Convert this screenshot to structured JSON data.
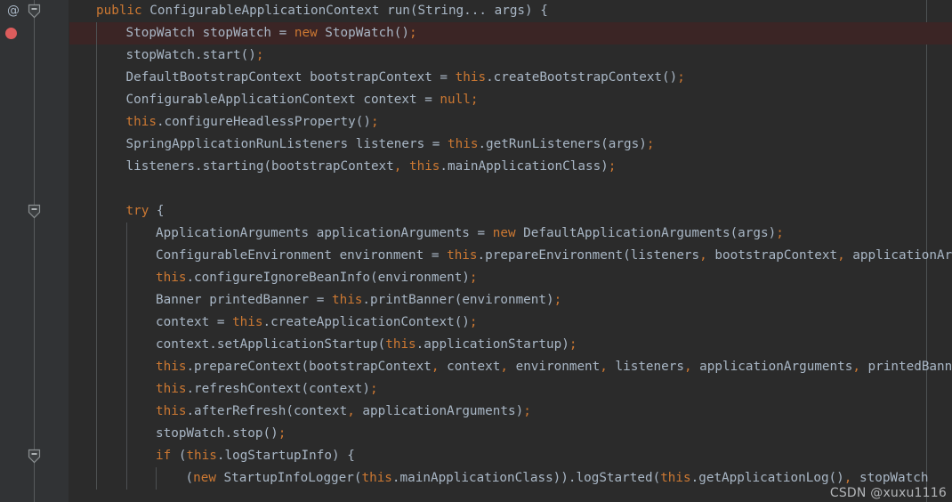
{
  "editor": {
    "theme_name": "darcula",
    "colors": {
      "background": "#2b2b2b",
      "gutter_background": "#313335",
      "foreground": "#a9b7c6",
      "keyword": "#cc7832",
      "breakpoint_line_background": "#3b2525",
      "breakpoint_dot": "#db5c5c",
      "indent_guide": "#4d5052",
      "margin_guide": "#4e5254"
    }
  },
  "gutter": {
    "annotation_icon": "@",
    "annotation_icon_name": "annotation-marker-icon",
    "breakpoint_icon_name": "breakpoint-dot-icon",
    "fold_icon_name": "code-fold-collapse-icon",
    "fold_markers": [
      0,
      9,
      20
    ]
  },
  "watermark": {
    "text": "CSDN @xuxu1116"
  },
  "code": {
    "language": "java",
    "lines": [
      {
        "indent": 0,
        "highlight": false,
        "guides": [],
        "tokens": [
          {
            "t": "public",
            "c": "kw"
          },
          {
            "t": " ConfigurableApplicationContext run(String... args) {",
            "c": "txt"
          }
        ]
      },
      {
        "indent": 1,
        "highlight": true,
        "guides": [
          0
        ],
        "tokens": [
          {
            "t": "StopWatch stopWatch = ",
            "c": "txt"
          },
          {
            "t": "new",
            "c": "kw"
          },
          {
            "t": " StopWatch()",
            "c": "txt"
          },
          {
            "t": ";",
            "c": "sem"
          }
        ]
      },
      {
        "indent": 1,
        "highlight": false,
        "guides": [
          0
        ],
        "tokens": [
          {
            "t": "stopWatch.start()",
            "c": "txt"
          },
          {
            "t": ";",
            "c": "sem"
          }
        ]
      },
      {
        "indent": 1,
        "highlight": false,
        "guides": [
          0
        ],
        "tokens": [
          {
            "t": "DefaultBootstrapContext bootstrapContext = ",
            "c": "txt"
          },
          {
            "t": "this",
            "c": "kw"
          },
          {
            "t": ".createBootstrapContext()",
            "c": "txt"
          },
          {
            "t": ";",
            "c": "sem"
          }
        ]
      },
      {
        "indent": 1,
        "highlight": false,
        "guides": [
          0
        ],
        "tokens": [
          {
            "t": "ConfigurableApplicationContext context = ",
            "c": "txt"
          },
          {
            "t": "null",
            "c": "kw"
          },
          {
            "t": ";",
            "c": "sem"
          }
        ]
      },
      {
        "indent": 1,
        "highlight": false,
        "guides": [
          0
        ],
        "tokens": [
          {
            "t": "this",
            "c": "kw"
          },
          {
            "t": ".configureHeadlessProperty()",
            "c": "txt"
          },
          {
            "t": ";",
            "c": "sem"
          }
        ]
      },
      {
        "indent": 1,
        "highlight": false,
        "guides": [
          0
        ],
        "tokens": [
          {
            "t": "SpringApplicationRunListeners listeners = ",
            "c": "txt"
          },
          {
            "t": "this",
            "c": "kw"
          },
          {
            "t": ".getRunListeners(args)",
            "c": "txt"
          },
          {
            "t": ";",
            "c": "sem"
          }
        ]
      },
      {
        "indent": 1,
        "highlight": false,
        "guides": [
          0
        ],
        "tokens": [
          {
            "t": "listeners.starting(bootstrapContext",
            "c": "txt"
          },
          {
            "t": ",",
            "c": "sem"
          },
          {
            "t": " ",
            "c": "txt"
          },
          {
            "t": "this",
            "c": "kw"
          },
          {
            "t": ".mainApplicationClass)",
            "c": "txt"
          },
          {
            "t": ";",
            "c": "sem"
          }
        ]
      },
      {
        "indent": 0,
        "highlight": false,
        "guides": [
          0
        ],
        "tokens": []
      },
      {
        "indent": 1,
        "highlight": false,
        "guides": [
          0
        ],
        "tokens": [
          {
            "t": "try",
            "c": "kw"
          },
          {
            "t": " {",
            "c": "txt"
          }
        ]
      },
      {
        "indent": 2,
        "highlight": false,
        "guides": [
          0,
          1
        ],
        "tokens": [
          {
            "t": "ApplicationArguments applicationArguments = ",
            "c": "txt"
          },
          {
            "t": "new",
            "c": "kw"
          },
          {
            "t": " DefaultApplicationArguments(args)",
            "c": "txt"
          },
          {
            "t": ";",
            "c": "sem"
          }
        ]
      },
      {
        "indent": 2,
        "highlight": false,
        "guides": [
          0,
          1
        ],
        "tokens": [
          {
            "t": "ConfigurableEnvironment environment = ",
            "c": "txt"
          },
          {
            "t": "this",
            "c": "kw"
          },
          {
            "t": ".prepareEnvironment(listeners",
            "c": "txt"
          },
          {
            "t": ",",
            "c": "sem"
          },
          {
            "t": " bootstrapContext",
            "c": "txt"
          },
          {
            "t": ",",
            "c": "sem"
          },
          {
            "t": " applicationArguments)",
            "c": "txt"
          },
          {
            "t": ";",
            "c": "sem"
          }
        ]
      },
      {
        "indent": 2,
        "highlight": false,
        "guides": [
          0,
          1
        ],
        "tokens": [
          {
            "t": "this",
            "c": "kw"
          },
          {
            "t": ".configureIgnoreBeanInfo(environment)",
            "c": "txt"
          },
          {
            "t": ";",
            "c": "sem"
          }
        ]
      },
      {
        "indent": 2,
        "highlight": false,
        "guides": [
          0,
          1
        ],
        "tokens": [
          {
            "t": "Banner printedBanner = ",
            "c": "txt"
          },
          {
            "t": "this",
            "c": "kw"
          },
          {
            "t": ".printBanner(environment)",
            "c": "txt"
          },
          {
            "t": ";",
            "c": "sem"
          }
        ]
      },
      {
        "indent": 2,
        "highlight": false,
        "guides": [
          0,
          1
        ],
        "tokens": [
          {
            "t": "context = ",
            "c": "txt"
          },
          {
            "t": "this",
            "c": "kw"
          },
          {
            "t": ".createApplicationContext()",
            "c": "txt"
          },
          {
            "t": ";",
            "c": "sem"
          }
        ]
      },
      {
        "indent": 2,
        "highlight": false,
        "guides": [
          0,
          1
        ],
        "tokens": [
          {
            "t": "context.setApplicationStartup(",
            "c": "txt"
          },
          {
            "t": "this",
            "c": "kw"
          },
          {
            "t": ".applicationStartup)",
            "c": "txt"
          },
          {
            "t": ";",
            "c": "sem"
          }
        ]
      },
      {
        "indent": 2,
        "highlight": false,
        "guides": [
          0,
          1
        ],
        "tokens": [
          {
            "t": "this",
            "c": "kw"
          },
          {
            "t": ".prepareContext(bootstrapContext",
            "c": "txt"
          },
          {
            "t": ",",
            "c": "sem"
          },
          {
            "t": " context",
            "c": "txt"
          },
          {
            "t": ",",
            "c": "sem"
          },
          {
            "t": " environment",
            "c": "txt"
          },
          {
            "t": ",",
            "c": "sem"
          },
          {
            "t": " listeners",
            "c": "txt"
          },
          {
            "t": ",",
            "c": "sem"
          },
          {
            "t": " applicationArguments",
            "c": "txt"
          },
          {
            "t": ",",
            "c": "sem"
          },
          {
            "t": " printedBanner)",
            "c": "txt"
          },
          {
            "t": ";",
            "c": "sem"
          }
        ]
      },
      {
        "indent": 2,
        "highlight": false,
        "guides": [
          0,
          1
        ],
        "tokens": [
          {
            "t": "this",
            "c": "kw"
          },
          {
            "t": ".refreshContext(context)",
            "c": "txt"
          },
          {
            "t": ";",
            "c": "sem"
          }
        ]
      },
      {
        "indent": 2,
        "highlight": false,
        "guides": [
          0,
          1
        ],
        "tokens": [
          {
            "t": "this",
            "c": "kw"
          },
          {
            "t": ".afterRefresh(context",
            "c": "txt"
          },
          {
            "t": ",",
            "c": "sem"
          },
          {
            "t": " applicationArguments)",
            "c": "txt"
          },
          {
            "t": ";",
            "c": "sem"
          }
        ]
      },
      {
        "indent": 2,
        "highlight": false,
        "guides": [
          0,
          1
        ],
        "tokens": [
          {
            "t": "stopWatch.stop()",
            "c": "txt"
          },
          {
            "t": ";",
            "c": "sem"
          }
        ]
      },
      {
        "indent": 2,
        "highlight": false,
        "guides": [
          0,
          1
        ],
        "tokens": [
          {
            "t": "if",
            "c": "kw"
          },
          {
            "t": " (",
            "c": "txt"
          },
          {
            "t": "this",
            "c": "kw"
          },
          {
            "t": ".logStartupInfo) {",
            "c": "txt"
          }
        ]
      },
      {
        "indent": 3,
        "highlight": false,
        "guides": [
          0,
          1,
          2
        ],
        "tokens": [
          {
            "t": "(",
            "c": "txt"
          },
          {
            "t": "new",
            "c": "kw"
          },
          {
            "t": " StartupInfoLogger(",
            "c": "txt"
          },
          {
            "t": "this",
            "c": "kw"
          },
          {
            "t": ".mainApplicationClass)).logStarted(",
            "c": "txt"
          },
          {
            "t": "this",
            "c": "kw"
          },
          {
            "t": ".getApplicationLog()",
            "c": "txt"
          },
          {
            "t": ",",
            "c": "sem"
          },
          {
            "t": " stopWatch",
            "c": "txt"
          }
        ]
      }
    ]
  }
}
